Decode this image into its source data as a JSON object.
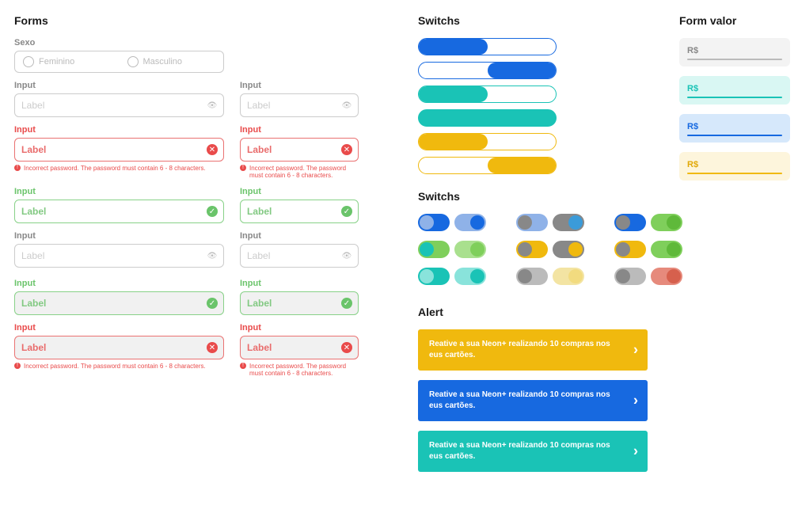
{
  "forms": {
    "title": "Forms",
    "sexo": {
      "label": "Sexo",
      "opt1": "Feminino",
      "opt2": "Masculino"
    },
    "inputLabel": "Input",
    "placeholder": "Label",
    "errorMsg": "Incorrect password. The password must contain 6 - 8 characters.",
    "errorMsgShort": "Incorrect password. The password must contain 6 - 8 characters."
  },
  "switchs": {
    "title": "Switchs"
  },
  "alert": {
    "title": "Alert",
    "msg": "Reative a sua Neon+ realizando 10 compras nos eus cartões."
  },
  "valor": {
    "title": "Form valor",
    "currency": "R$"
  }
}
